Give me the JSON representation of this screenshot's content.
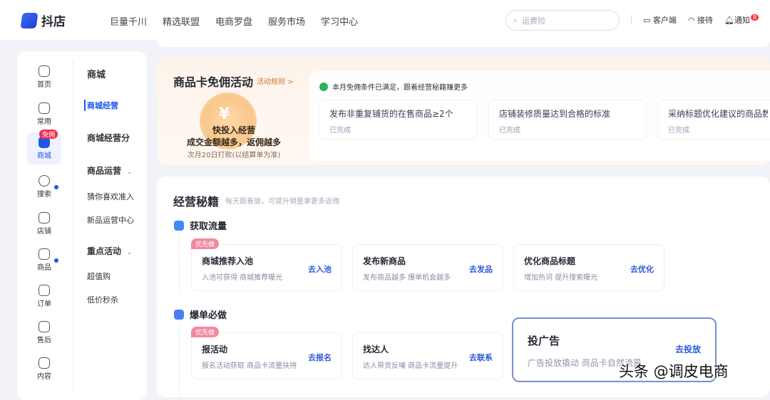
{
  "header": {
    "logo": "抖店",
    "nav": [
      "巨量千川",
      "精选联盟",
      "电商罗盘",
      "服务市场",
      "学习中心"
    ],
    "search_placeholder": "运费险",
    "client": "客户端",
    "reception": "接待",
    "notify": "通知",
    "notify_count": "8"
  },
  "rail": {
    "items": [
      {
        "label": "首页"
      },
      {
        "label": "常用"
      },
      {
        "label": "商城",
        "badge": "免佣"
      },
      {
        "label": "搜索"
      },
      {
        "label": "店铺"
      },
      {
        "label": "商品"
      },
      {
        "label": "订单"
      },
      {
        "label": "售后"
      },
      {
        "label": "内容"
      }
    ],
    "sub": {
      "title": "商城",
      "active": "商城经营",
      "score": "商城经营分",
      "group1": "商品运营",
      "g1": [
        "猜你喜欢准入",
        "新品运营中心"
      ],
      "group2": "重点活动",
      "g2": [
        "超值购",
        "低价秒杀"
      ]
    }
  },
  "promo": {
    "title": "商品卡免佣活动",
    "rule": "活动规则 >",
    "coin": "¥",
    "line1": "快投入经营",
    "line2": "成交金额越多，返佣越多",
    "line3": "次月20日打款(以结算单为准)",
    "status": "本月免佣条件已满足，跟着经营秘籍赚更多",
    "tasks": [
      {
        "title": "发布非重复铺货的在售商品≥2个",
        "state": "已完成"
      },
      {
        "title": "店铺装修质量达到合格的标准",
        "state": "已完成"
      },
      {
        "title": "采纳标题优化建议的商品数",
        "state": "已完成"
      }
    ]
  },
  "tips": {
    "title": "经营秘籍",
    "subtitle": "每天跟着做，可提升销量拿更多返佣",
    "priority": "优先做",
    "sections": [
      {
        "title": "获取流量",
        "cards": [
          {
            "title": "商城推荐入池",
            "desc": "入池可获得 商城推荐曝光",
            "action": "去入池"
          },
          {
            "title": "发布新商品",
            "desc": "发布商品越多 爆单机会越多",
            "action": "去发品"
          },
          {
            "title": "优化商品标题",
            "desc": "增加热词 提升搜索曝光",
            "action": "去优化"
          }
        ]
      },
      {
        "title": "爆单必做",
        "cards": [
          {
            "title": "报活动",
            "desc": "报名活动获取 商品卡流量扶持",
            "action": "去报名"
          },
          {
            "title": "找达人",
            "desc": "达人带货反哺 商品卡流量提升",
            "action": "去联系"
          },
          {
            "title": "投广告",
            "desc": "广告投放撬动 商品卡自然流量",
            "action": "去投放"
          }
        ]
      }
    ]
  },
  "watermark": "头条 @调皮电商"
}
